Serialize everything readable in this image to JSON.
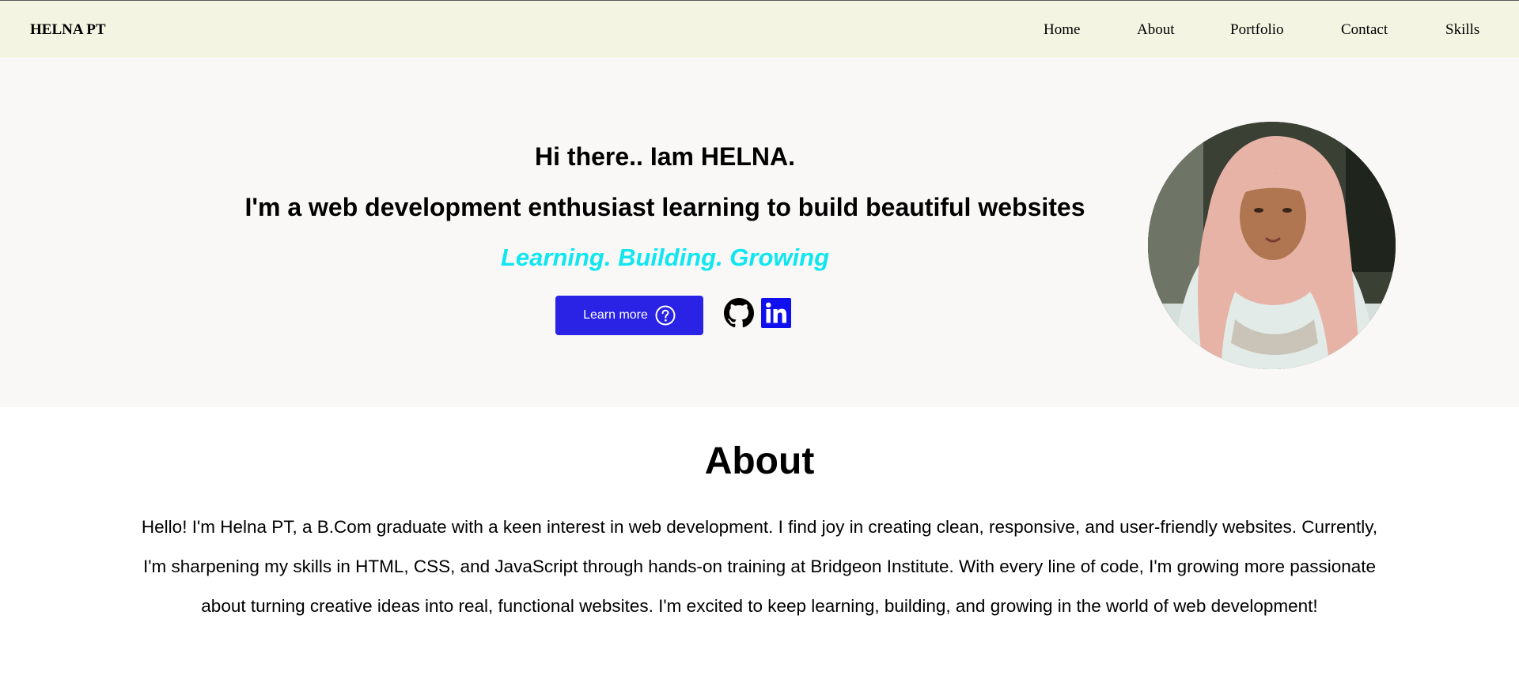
{
  "navbar": {
    "brand": "HELNA PT",
    "links": [
      "Home",
      "About",
      "Portfolio",
      "Contact",
      "Skills"
    ]
  },
  "hero": {
    "greeting": "Hi there.. Iam HELNA.",
    "headline": "I'm a web development enthusiast learning to build beautiful websites",
    "tagline": "Learning. Building. Growing",
    "learn_more_label": "Learn more",
    "icons": [
      "question-circle-icon",
      "github-icon",
      "linkedin-icon"
    ],
    "accent_color": "#0fe6f0",
    "button_color": "#2a22e5",
    "linkedin_color": "#1010ee"
  },
  "about": {
    "title": "About",
    "text": "Hello! I'm Helna PT, a B.Com graduate with a keen interest in web development. I find joy in creating clean, responsive, and user-friendly websites. Currently, I'm sharpening my skills in HTML, CSS, and JavaScript through hands-on training at Bridgeon Institute. With every line of code, I'm growing more passionate about turning creative ideas into real, functional websites. I'm excited to keep learning, building, and growing in the world of web development!"
  }
}
